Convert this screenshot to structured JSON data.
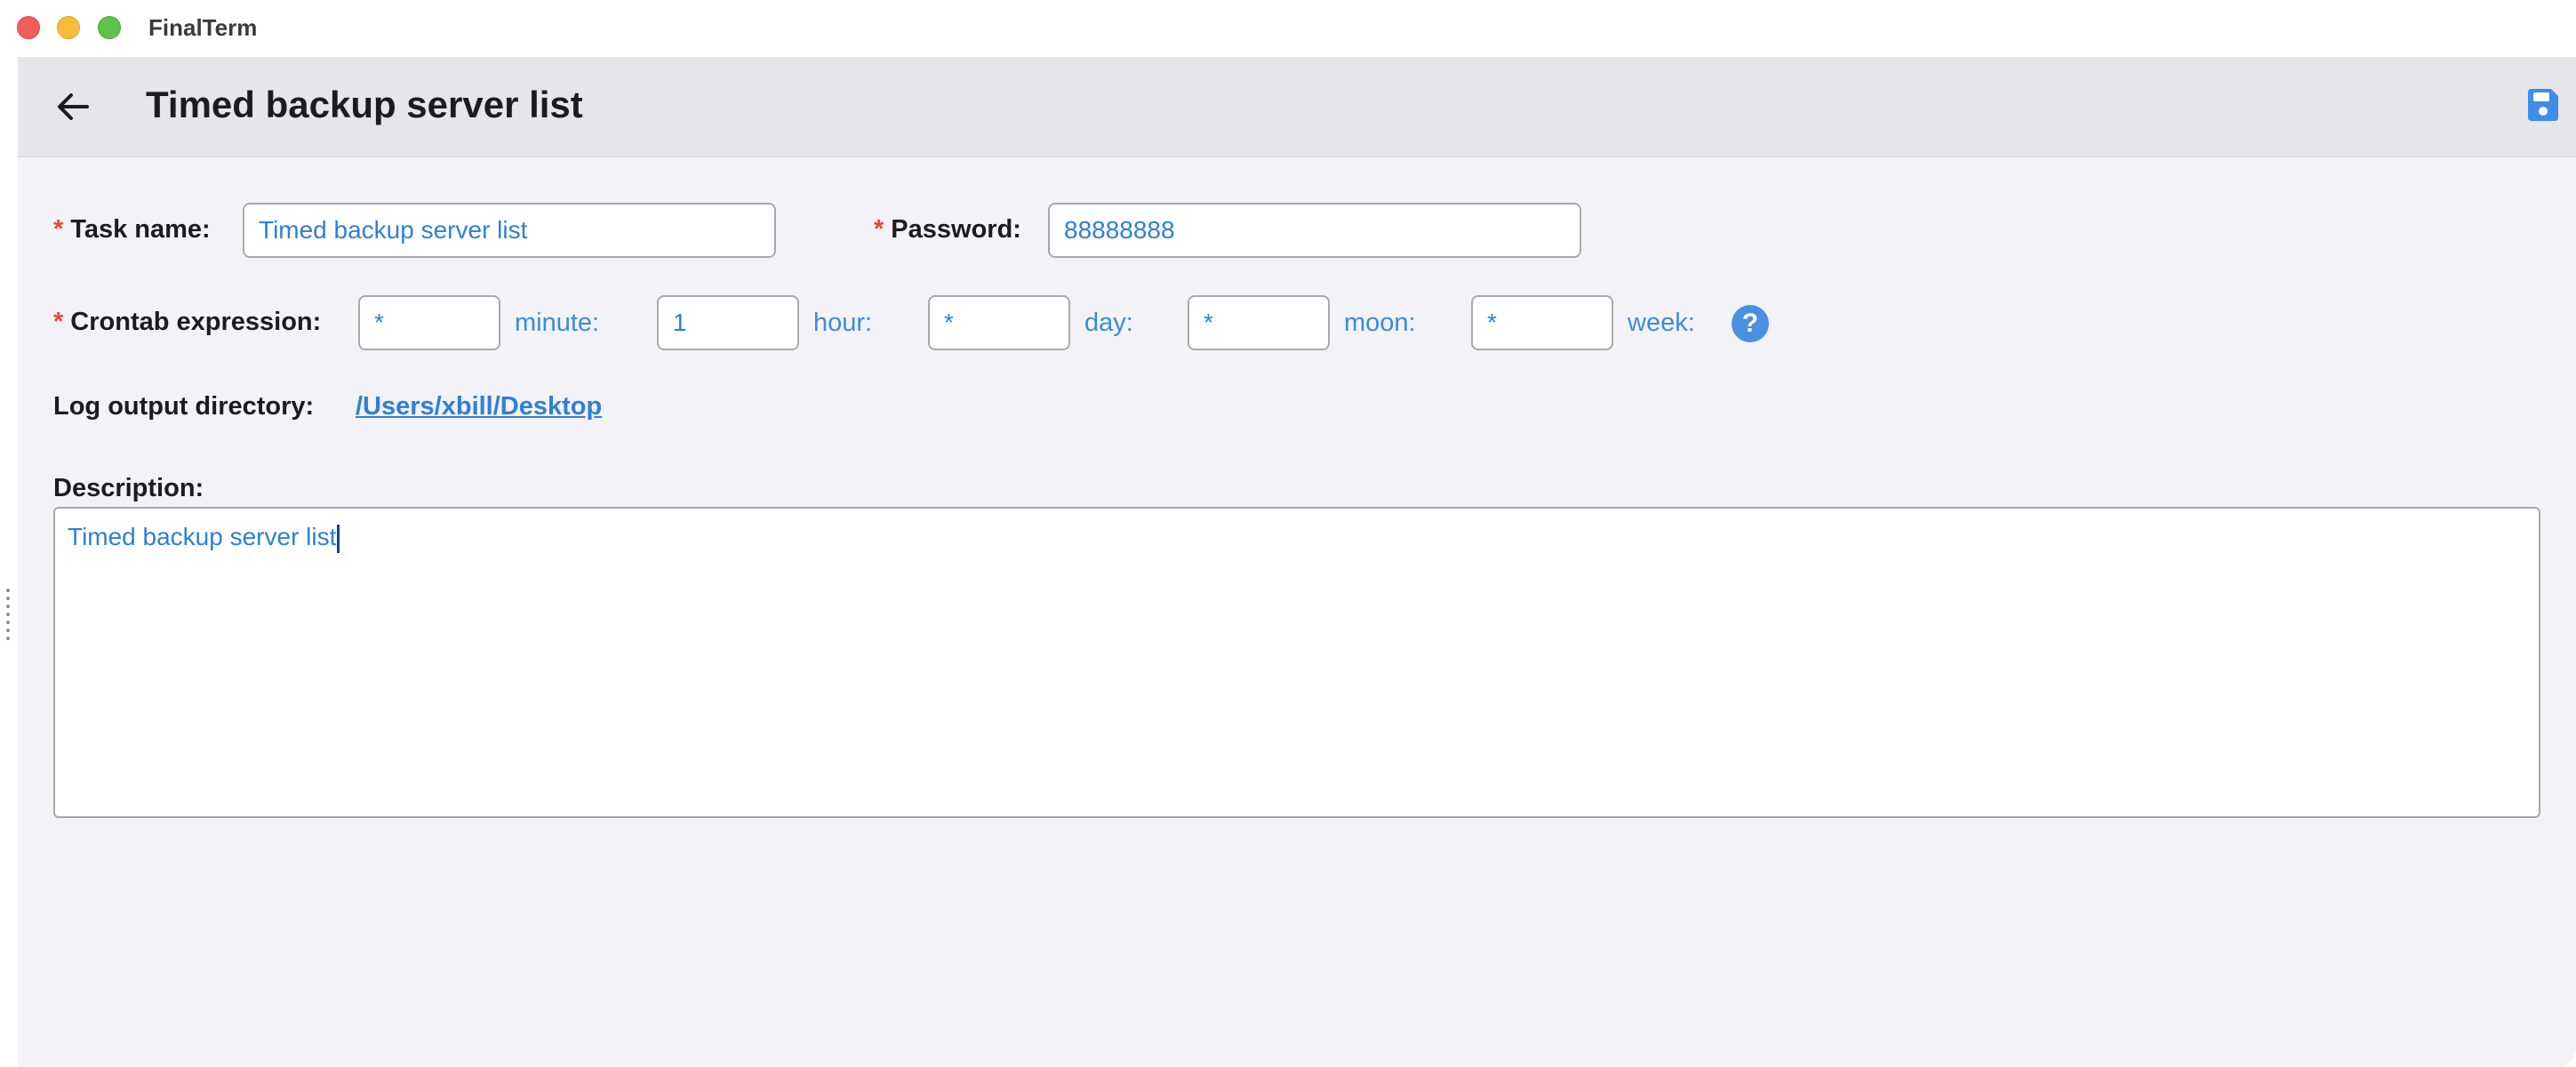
{
  "window": {
    "app_title": "FinalTerm"
  },
  "header": {
    "title": "Timed backup server list",
    "back_icon": "arrow-left-icon",
    "save_icon": "floppy-disk-icon"
  },
  "form": {
    "task_name": {
      "required_mark": "*",
      "label": "Task name:",
      "value": "Timed backup server list"
    },
    "password": {
      "required_mark": "*",
      "label": "Password:",
      "value": "88888888"
    },
    "crontab": {
      "required_mark": "*",
      "label": "Crontab expression:",
      "fields": [
        {
          "value": "*",
          "unit": "minute:"
        },
        {
          "value": "1",
          "unit": "hour:"
        },
        {
          "value": "*",
          "unit": "day:"
        },
        {
          "value": "*",
          "unit": "moon:"
        },
        {
          "value": "*",
          "unit": "week:"
        }
      ],
      "help_label": "?"
    },
    "log_output": {
      "label": "Log output directory:",
      "path": "/Users/xbill/Desktop"
    },
    "description": {
      "label": "Description:",
      "value": "Timed backup server list"
    }
  },
  "colors": {
    "accent": "#2f7fd6",
    "required": "#e5483f",
    "header_bg": "#e5e5ea",
    "page_bg": "#f2f2f7"
  }
}
